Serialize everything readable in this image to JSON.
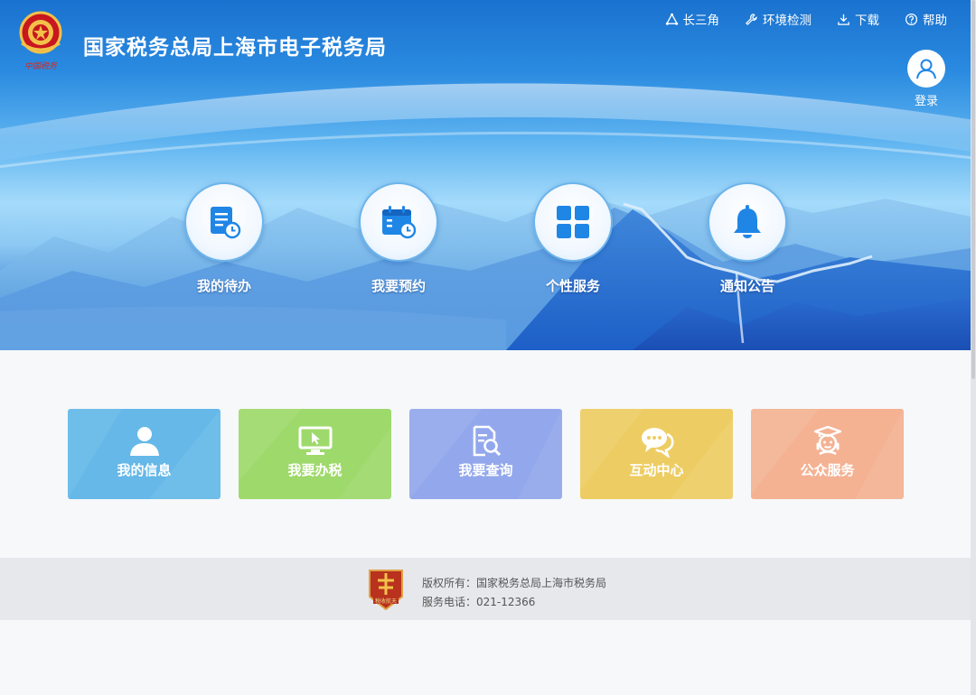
{
  "header": {
    "site_title": "国家税务总局上海市电子税务局",
    "logo_text": "中国税务",
    "nav": [
      {
        "label": "长三角",
        "icon": "triangle-network-icon"
      },
      {
        "label": "环境检测",
        "icon": "wrench-icon"
      },
      {
        "label": "下载",
        "icon": "download-icon"
      },
      {
        "label": "帮助",
        "icon": "help-icon"
      }
    ],
    "login_label": "登录"
  },
  "hero_menu": [
    {
      "label": "我的待办",
      "icon": "todo-document-icon"
    },
    {
      "label": "我要预约",
      "icon": "calendar-clock-icon"
    },
    {
      "label": "个性服务",
      "icon": "grid-apps-icon"
    },
    {
      "label": "通知公告",
      "icon": "bell-icon"
    }
  ],
  "cards": [
    {
      "label": "我的信息",
      "icon": "user-icon",
      "color": "#65b8e8"
    },
    {
      "label": "我要办税",
      "icon": "monitor-cursor-icon",
      "color": "#9ed96b"
    },
    {
      "label": "我要查询",
      "icon": "document-search-icon",
      "color": "#93a8ec"
    },
    {
      "label": "互动中心",
      "icon": "chat-bubbles-icon",
      "color": "#edcd63"
    },
    {
      "label": "公众服务",
      "icon": "headset-agent-icon",
      "color": "#f4b293"
    }
  ],
  "footer": {
    "badge_text": "税收航天",
    "copyright": "版权所有：国家税务总局上海市税务局",
    "phone": "服务电话：021-12366"
  },
  "colors": {
    "hero_blue": "#1a72cf",
    "icon_blue": "#1f86e6",
    "footer_bg": "#e7e8ec"
  }
}
